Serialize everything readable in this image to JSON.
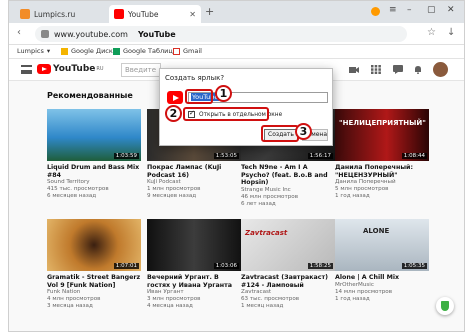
{
  "browser": {
    "tabs": [
      {
        "label": "Lumpics.ru",
        "active": false
      },
      {
        "label": "YouTube",
        "active": true
      }
    ],
    "url": "www.youtube.com",
    "page_title": "YouTube",
    "bookmarks": [
      "Lumpics",
      "Google Диск",
      "Google Таблицы",
      "Gmail"
    ]
  },
  "youtube": {
    "logo_text": "YouTube",
    "logo_region": "RU",
    "search_placeholder": "Введите",
    "section_title": "Рекомендованные"
  },
  "videos": [
    {
      "title": "Liquid Drum and Bass Mix #84",
      "channel": "Sound Territory",
      "views": "415 тыс. просмотров",
      "age": "6 месяцев назад",
      "duration": "1:03:59"
    },
    {
      "title": "Покрас Лампас (KuJi Podcast 16)",
      "channel": "KuJi Podcast",
      "views": "1 млн просмотров",
      "age": "9 месяцев назад",
      "duration": "1:53:05"
    },
    {
      "title": "Tech N9ne - Am I A Psycho? (feat. B.o.B and Hopsin)",
      "channel": "Strange Music Inc",
      "views": "46 млн просмотров",
      "age": "6 лет назад",
      "duration": "1:56:17"
    },
    {
      "title": "Данила Поперечный: \"НЕЦЕНЗУРНЫЙ\"",
      "channel": "Данила Поперечный",
      "views": "5 млн просмотров",
      "age": "1 год назад",
      "duration": "1:08:44",
      "overlay": "\"НЕЛИЦЕПРИЯТНЫЙ\""
    },
    {
      "title": "Gramatik - Street Bangerz Vol 9 [Funk Nation]",
      "channel": "Funk Nation",
      "views": "4 млн просмотров",
      "age": "3 месяца назад",
      "duration": "1:07:01"
    },
    {
      "title": "Вечерний Ургант. В гостях у Ивана Урганта",
      "channel": "Иван Ургант",
      "views": "3 млн просмотров",
      "age": "4 месяца назад",
      "duration": "1:03:06"
    },
    {
      "title": "Zavtracast (Завтракаст) #124 - Ламповый",
      "channel": "Zavtracast",
      "views": "63 тыс. просмотров",
      "age": "1 месяц назад",
      "duration": "1:58:25",
      "overlay": "Zavtracast"
    },
    {
      "title": "Alone | A Chill Mix",
      "channel": "MrOtherMusic",
      "views": "14 млн просмотров",
      "age": "1 год назад",
      "duration": "1:05:35",
      "overlay": "ALONE"
    }
  ],
  "dialog": {
    "title": "Создать ярлык?",
    "input_value": "YouTube",
    "checkbox_label": "Открыть в отдельном окне",
    "checkbox_checked": true,
    "create_label": "Создать",
    "cancel_label": "Отмена"
  },
  "steps": [
    "1",
    "2",
    "3"
  ],
  "colors": {
    "accent_red": "#d01010",
    "youtube_red": "#ff0000",
    "selection_blue": "#2a66c9"
  }
}
